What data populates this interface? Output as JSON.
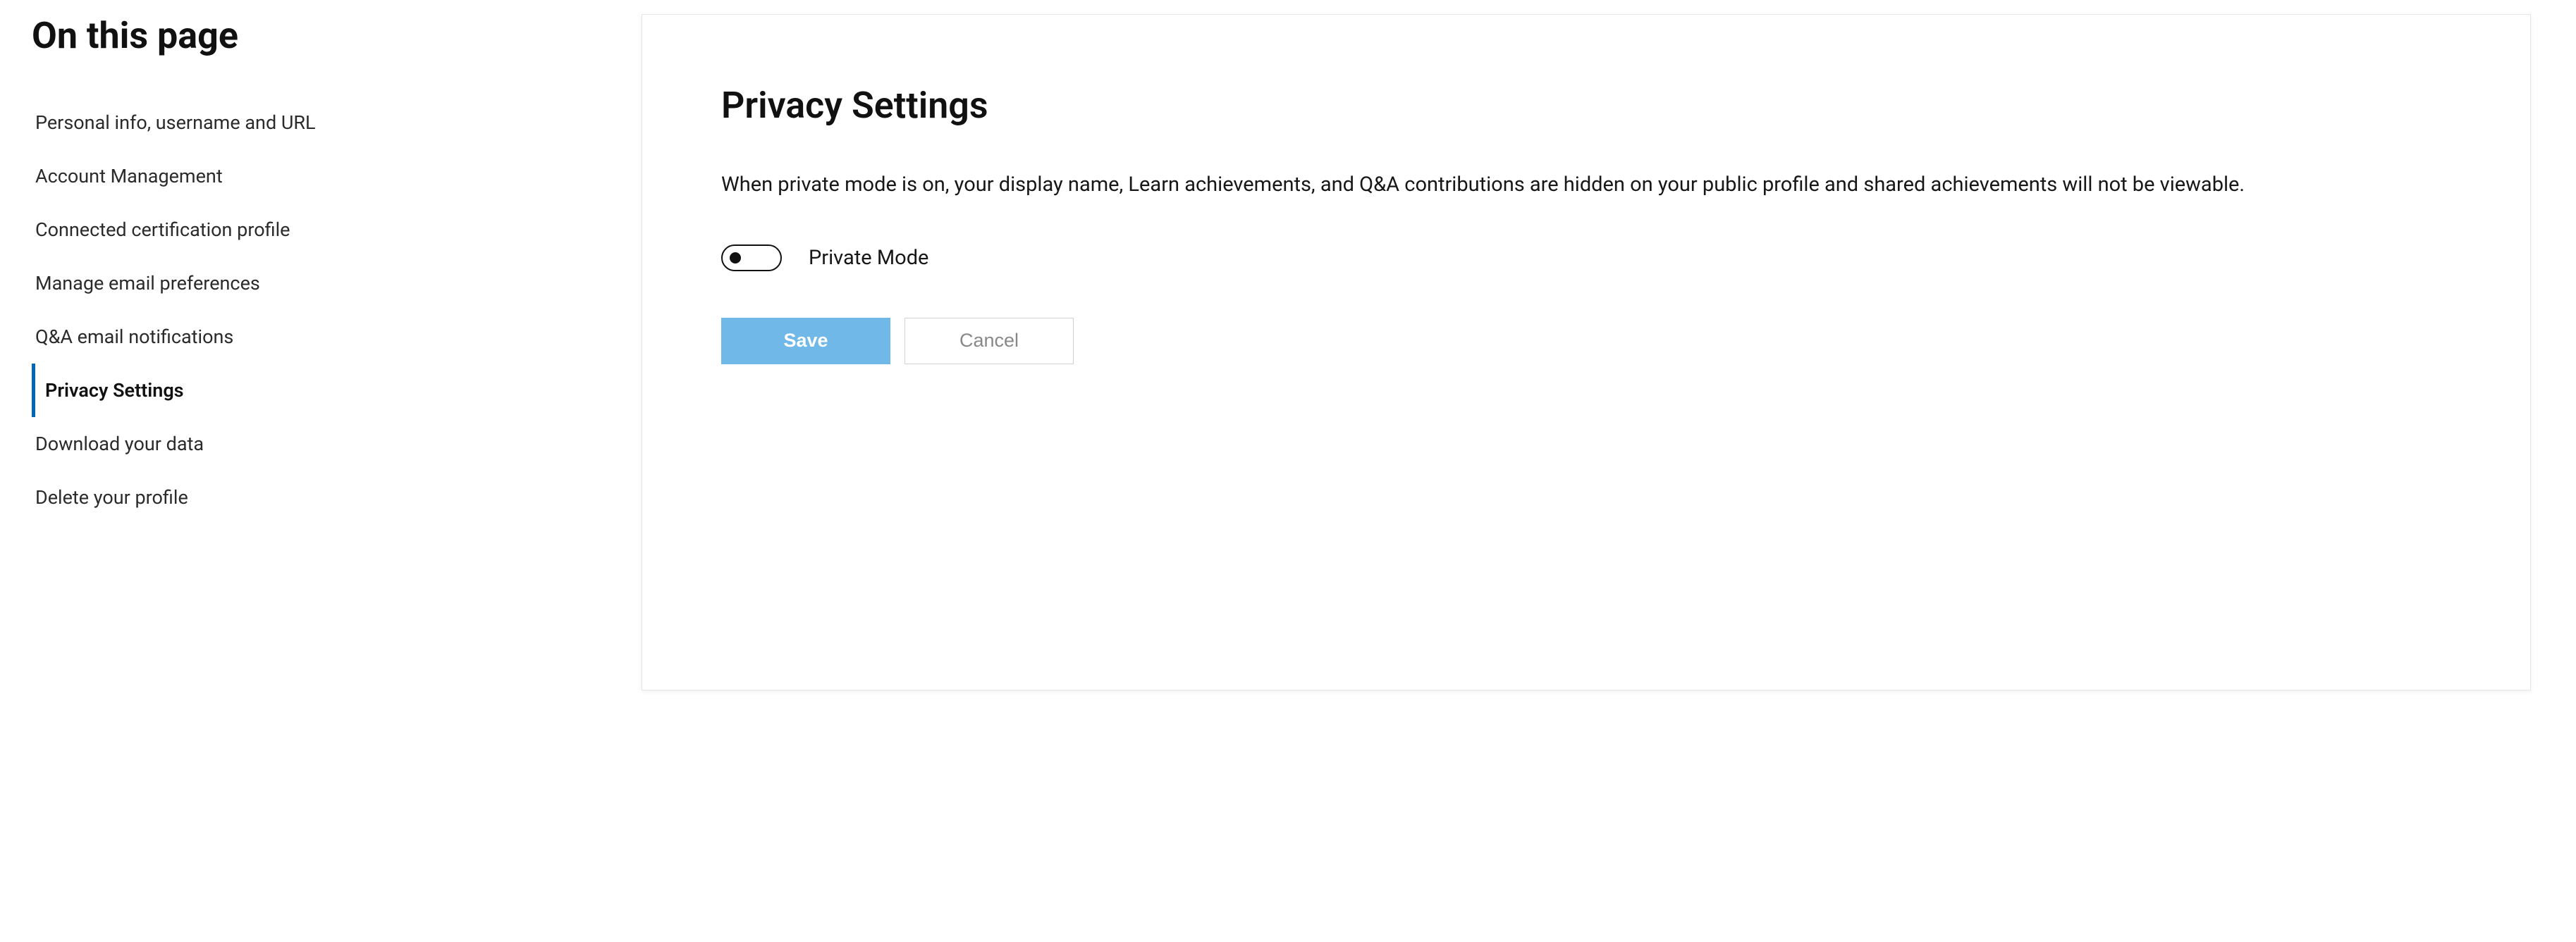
{
  "sidebar": {
    "heading": "On this page",
    "items": [
      {
        "label": "Personal info, username and URL",
        "active": false
      },
      {
        "label": "Account Management",
        "active": false
      },
      {
        "label": "Connected certification profile",
        "active": false
      },
      {
        "label": "Manage email preferences",
        "active": false
      },
      {
        "label": "Q&A email notifications",
        "active": false
      },
      {
        "label": "Privacy Settings",
        "active": true
      },
      {
        "label": "Download your data",
        "active": false
      },
      {
        "label": "Delete your profile",
        "active": false
      }
    ]
  },
  "main": {
    "title": "Privacy Settings",
    "description": "When private mode is on, your display name, Learn achievements, and Q&A contributions are hidden on your public profile and shared achievements will not be viewable.",
    "toggle": {
      "label": "Private Mode",
      "on": false
    },
    "buttons": {
      "save_label": "Save",
      "cancel_label": "Cancel"
    }
  }
}
